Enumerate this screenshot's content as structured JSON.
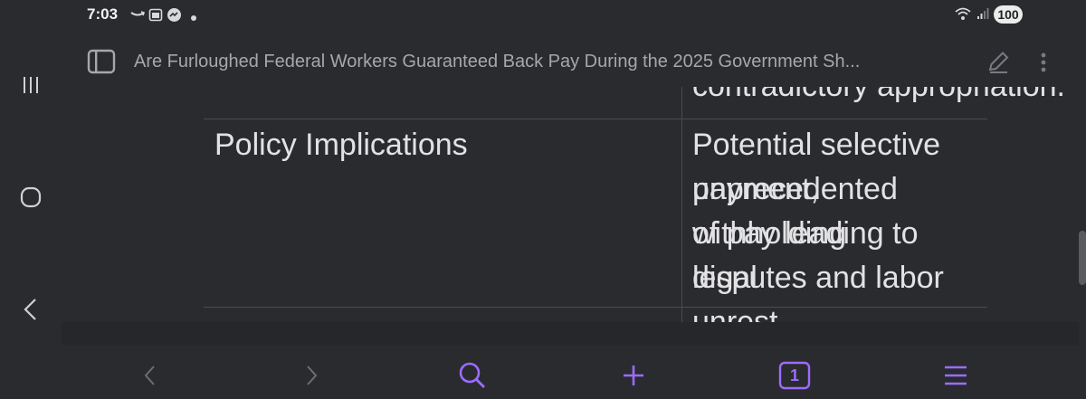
{
  "status_bar": {
    "time": "7:03",
    "battery": "100",
    "notification_icons": [
      "amazon-icon",
      "calendar-icon",
      "messenger-icon",
      "dot-icon"
    ],
    "system_icons": [
      "wifi-icon",
      "signal-icon",
      "battery-icon"
    ]
  },
  "titlebar": {
    "title": "Are Furloughed Federal Workers Guaranteed Back Pay During the 2025 Government Sh..."
  },
  "table": {
    "partial_top_text": "contradictory appropriation.",
    "row": {
      "label": "Policy Implications",
      "lines": [
        "Potential selective payment,",
        "unprecedented withholding",
        "of pay leading to legal",
        "disputes and labor unrest."
      ]
    }
  },
  "colors": {
    "background": "#2a2b2f",
    "accent": "#8b5cf6",
    "text": "#e2e2e4",
    "muted": "#a6a7ab"
  },
  "bottom_bar": {
    "tab_count": "1"
  }
}
